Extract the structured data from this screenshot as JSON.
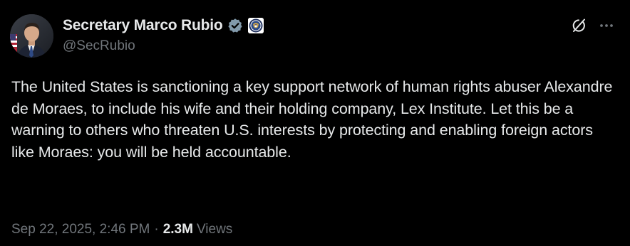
{
  "author": {
    "display_name": "Secretary Marco Rubio",
    "handle": "@SecRubio",
    "verified": true,
    "verified_color": "#829aab",
    "affiliation_badge": "state-department-seal-icon"
  },
  "tweet": {
    "text": "The United States is sanctioning a key support network of human rights abuser Alexandre de Moraes, to include his wife and their holding company, Lex Institute. Let this be a warning to others who threaten U.S. interests by protecting and enabling foreign actors like Moraes: you will be held accountable.",
    "timestamp": "Sep 22, 2025, 2:46 PM",
    "separator": "·",
    "views_count": "2.3M",
    "views_label": "Views"
  },
  "actions": {
    "grok_icon": "grok-icon",
    "more_icon": "more-options-icon"
  },
  "colors": {
    "background": "#000000",
    "primary_text": "#e7e9ea",
    "secondary_text": "#71767b"
  }
}
